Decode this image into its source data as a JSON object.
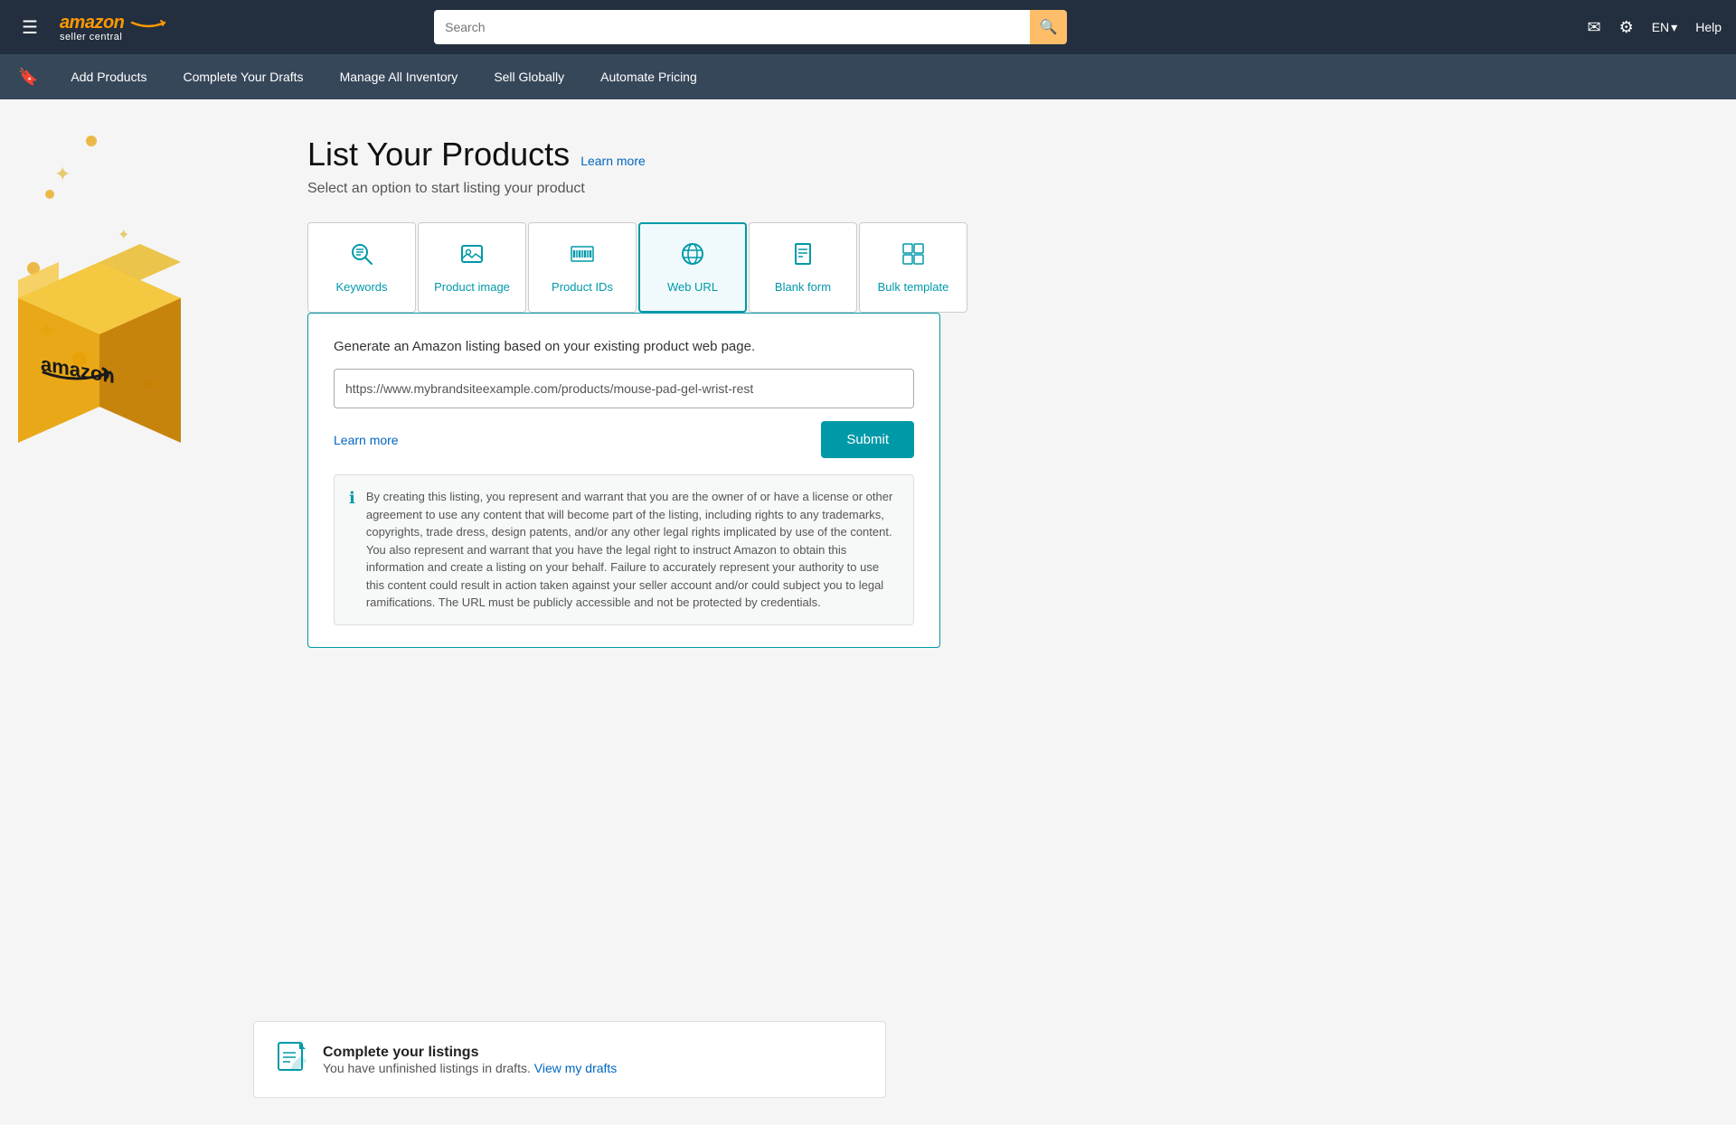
{
  "topNav": {
    "hamburger_label": "☰",
    "logo_amazon": "amazon",
    "logo_seller": "seller central",
    "search_placeholder": "Search",
    "search_icon": "🔍",
    "mail_icon": "✉",
    "gear_icon": "⚙",
    "lang_label": "EN",
    "lang_chevron": "▾",
    "help_label": "Help"
  },
  "secNav": {
    "bookmark_icon": "🔖",
    "links": [
      {
        "label": "Add Products",
        "id": "add-products"
      },
      {
        "label": "Complete Your Drafts",
        "id": "complete-drafts"
      },
      {
        "label": "Manage All Inventory",
        "id": "manage-inventory"
      },
      {
        "label": "Sell Globally",
        "id": "sell-globally"
      },
      {
        "label": "Automate Pricing",
        "id": "automate-pricing"
      }
    ]
  },
  "page": {
    "title": "List Your Products",
    "learn_more": "Learn more",
    "subtitle": "Select an option to start listing your product",
    "options": [
      {
        "label": "Keywords",
        "icon": "🔍",
        "id": "keywords"
      },
      {
        "label": "Product image",
        "icon": "📷",
        "id": "product-image"
      },
      {
        "label": "Product IDs",
        "icon": "▐▌▌▌▌",
        "id": "product-ids"
      },
      {
        "label": "Web URL",
        "icon": "🌐",
        "id": "web-url",
        "active": true
      },
      {
        "label": "Blank form",
        "icon": "📄",
        "id": "blank-form"
      },
      {
        "label": "Bulk template",
        "icon": "⊞",
        "id": "bulk-template"
      }
    ],
    "content_box": {
      "description": "Generate an Amazon listing based on your existing product web page.",
      "url_value": "https://www.mybrandsiteexample.com/products/mouse-pad-gel-wrist-rest",
      "learn_more_label": "Learn more",
      "submit_label": "Submit",
      "legal_text": "By creating this listing, you represent and warrant that you are the owner of or have a license or other agreement to use any content that will become part of the listing, including rights to any trademarks, copyrights, trade dress, design patents, and/or any other legal rights implicated by use of the content. You also represent and warrant that you have the legal right to instruct Amazon to obtain this information and create a listing on your behalf. Failure to accurately represent your authority to use this content could result in action taken against your seller account and/or could subject you to legal ramifications. The URL must be publicly accessible and not be protected by credentials."
    },
    "banner": {
      "title": "Complete your listings",
      "subtitle": "You have unfinished listings in drafts.",
      "link_label": "View my drafts"
    }
  }
}
